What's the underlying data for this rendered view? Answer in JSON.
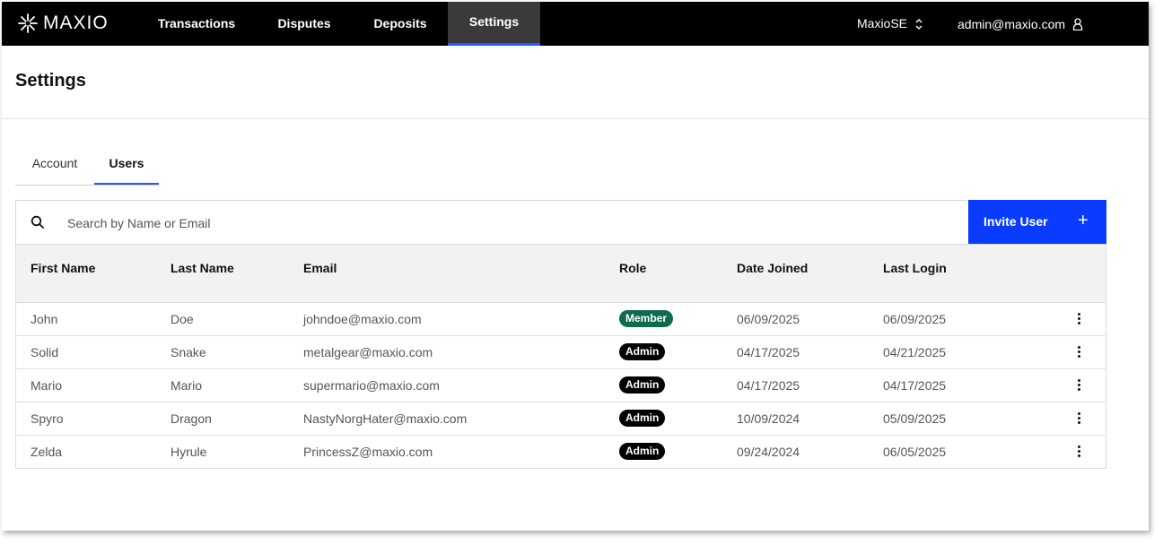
{
  "brand": {
    "name": "MAXIO"
  },
  "nav": {
    "items": [
      {
        "label": "Transactions"
      },
      {
        "label": "Disputes"
      },
      {
        "label": "Deposits"
      },
      {
        "label": "Settings"
      }
    ],
    "active": "Settings",
    "tenant": "MaxioSE",
    "user_email": "admin@maxio.com"
  },
  "page": {
    "title": "Settings"
  },
  "tabs": [
    {
      "label": "Account"
    },
    {
      "label": "Users"
    }
  ],
  "active_tab": "Users",
  "search": {
    "placeholder": "Search by Name or Email",
    "value": ""
  },
  "invite_button": {
    "label": "Invite User"
  },
  "table": {
    "columns": [
      "First Name",
      "Last Name",
      "Email",
      "Role",
      "Date Joined",
      "Last Login"
    ],
    "rows": [
      {
        "first": "John",
        "last": "Doe",
        "email": "johndoe@maxio.com",
        "role": "Member",
        "joined": "06/09/2025",
        "last_login": "06/09/2025"
      },
      {
        "first": "Solid",
        "last": "Snake",
        "email": "metalgear@maxio.com",
        "role": "Admin",
        "joined": "04/17/2025",
        "last_login": "04/21/2025"
      },
      {
        "first": "Mario",
        "last": "Mario",
        "email": "supermario@maxio.com",
        "role": "Admin",
        "joined": "04/17/2025",
        "last_login": "04/17/2025"
      },
      {
        "first": "Spyro",
        "last": "Dragon",
        "email": "NastyNorgHater@maxio.com",
        "role": "Admin",
        "joined": "10/09/2024",
        "last_login": "05/09/2025"
      },
      {
        "first": "Zelda",
        "last": "Hyrule",
        "email": "PrincessZ@maxio.com",
        "role": "Admin",
        "joined": "09/24/2024",
        "last_login": "06/05/2025"
      }
    ]
  },
  "colors": {
    "nav_bg": "#000000",
    "accent": "#0a3cff",
    "member_badge": "#0f6b4f",
    "admin_badge": "#000000"
  }
}
